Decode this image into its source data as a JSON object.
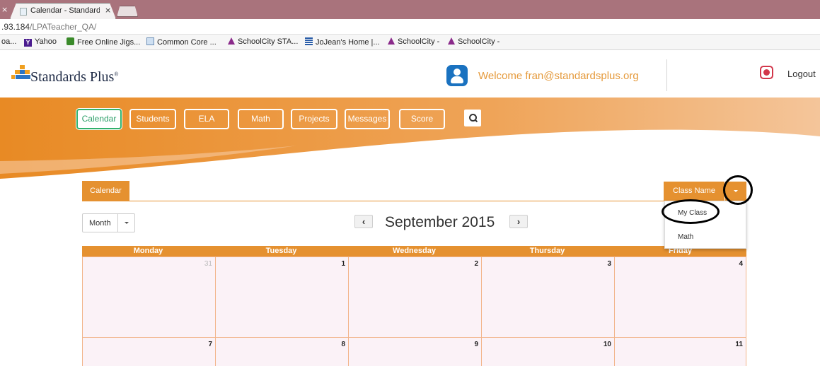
{
  "browser": {
    "tab_title": "Calendar - Standards",
    "tab_close": "×",
    "left_tab_close": "×",
    "url_host": ".93.184",
    "url_path": "/LPATeacher_QA/",
    "bookmarks": [
      {
        "label": "oa...",
        "icon": "none"
      },
      {
        "label": "Yahoo",
        "icon": "yahoo-icon"
      },
      {
        "label": "Free Online Jigs...",
        "icon": "jigsaw-icon"
      },
      {
        "label": "Common Core ...",
        "icon": "document-icon"
      },
      {
        "label": "SchoolCity STA...",
        "icon": "schoolcity-icon"
      },
      {
        "label": "JoJean's Home |...",
        "icon": "jojean-icon"
      },
      {
        "label": "SchoolCity -",
        "icon": "schoolcity-icon"
      },
      {
        "label": "SchoolCity -",
        "icon": "schoolcity-icon"
      }
    ]
  },
  "header": {
    "logo_text": "Standards Plus",
    "logo_mark": "®",
    "welcome": "Welcome fran@standardsplus.org",
    "logout": "Logout"
  },
  "nav": {
    "items": [
      "Calendar",
      "Students",
      "ELA",
      "Math",
      "Projects",
      "Messages",
      "Score"
    ],
    "active": "Calendar",
    "search_icon": "search-icon"
  },
  "calendar": {
    "tab_label": "Calendar",
    "class_select_label": "Class Name",
    "class_options": [
      "My Class",
      "Math"
    ],
    "view_select": "Month",
    "month_title": "September 2015",
    "prev_arrow": "‹",
    "next_arrow": "›",
    "weekdays": [
      "Monday",
      "Tuesday",
      "Wednesday",
      "Thursday",
      "Friday"
    ],
    "weeks": [
      [
        "31",
        "1",
        "2",
        "3",
        "4"
      ],
      [
        "7",
        "8",
        "9",
        "10",
        "11"
      ]
    ]
  },
  "colors": {
    "accent_orange": "#e59130",
    "nav_active_border": "#31b16c",
    "welcome_text": "#e59a3c",
    "cell_bg": "#fbf2f7"
  }
}
